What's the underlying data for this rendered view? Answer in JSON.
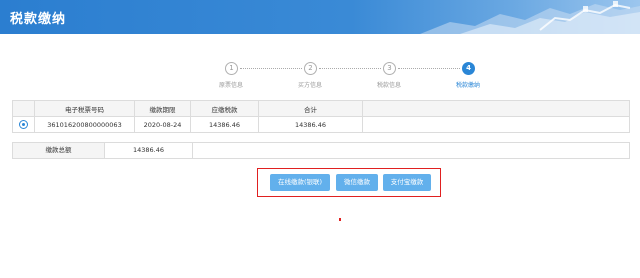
{
  "header": {
    "title": "税款缴纳"
  },
  "stepper": {
    "steps": [
      {
        "number": "1",
        "label": "原票信息"
      },
      {
        "number": "2",
        "label": "买方信息"
      },
      {
        "number": "3",
        "label": "税款信息"
      },
      {
        "number": "4",
        "label": "税款缴纳"
      }
    ],
    "active_step": 4
  },
  "table": {
    "headers": [
      "电子税票号码",
      "缴款期限",
      "应缴税款",
      "合计"
    ],
    "rows": [
      {
        "selected": true,
        "cells": [
          "361016200800000063",
          "2020-08-24",
          "14386.46",
          "14386.46"
        ]
      }
    ]
  },
  "total": {
    "label": "缴款总额",
    "value": "14386.46"
  },
  "actions": {
    "online_label": "在线缴款(银联)",
    "wechat_label": "微信缴款",
    "alipay_label": "支付宝缴款"
  },
  "colors": {
    "header": "#3a8ad6",
    "accent": "#2a86d6",
    "button": "#62b0ec",
    "highlight_border": "#e02020"
  }
}
